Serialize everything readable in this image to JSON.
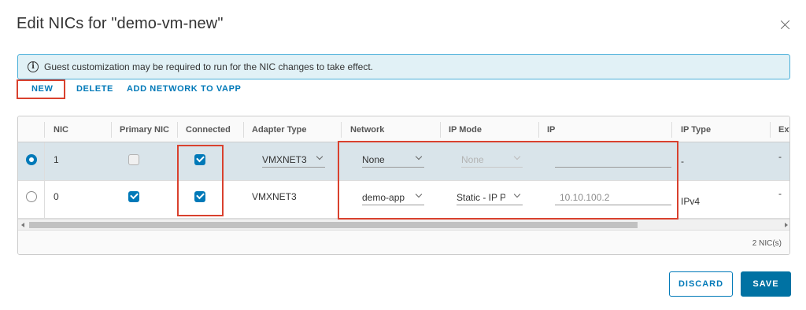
{
  "dialog": {
    "title": "Edit NICs for \"demo-vm-new\"",
    "close_icon": "close-icon"
  },
  "banner": {
    "icon": "info-icon",
    "text": "Guest customization may be required to run for the NIC changes to take effect."
  },
  "actions": {
    "new_label": "NEW",
    "delete_label": "DELETE",
    "add_network_label": "ADD NETWORK TO VAPP"
  },
  "table": {
    "columns": [
      "NIC",
      "Primary NIC",
      "Connected",
      "Adapter Type",
      "Network",
      "IP Mode",
      "IP",
      "IP Type",
      "Ext"
    ],
    "rows": [
      {
        "selected": true,
        "nic": "1",
        "primary_nic": false,
        "primary_nic_disabled": true,
        "connected": true,
        "adapter_type": "VMXNET3",
        "network": "None",
        "ip_mode": "None",
        "ip_mode_disabled": true,
        "ip": "",
        "ip_type": "-",
        "ext": "-"
      },
      {
        "selected": false,
        "nic": "0",
        "primary_nic": true,
        "connected": true,
        "adapter_type": "VMXNET3",
        "network": "demo-app",
        "ip_mode": "Static - IP Pool",
        "ip": "10.10.100.2",
        "ip_type": "IPv4",
        "ext": "-"
      }
    ],
    "footer_count": "2 NIC(s)"
  },
  "buttons": {
    "discard_label": "DISCARD",
    "save_label": "SAVE"
  },
  "colors": {
    "accent": "#0079b8",
    "primary_button": "#0072a3",
    "banner_bg": "#e1f1f6",
    "banner_border": "#49afd9",
    "selected_row": "#d9e4ea",
    "highlight_red": "#d9412e"
  }
}
